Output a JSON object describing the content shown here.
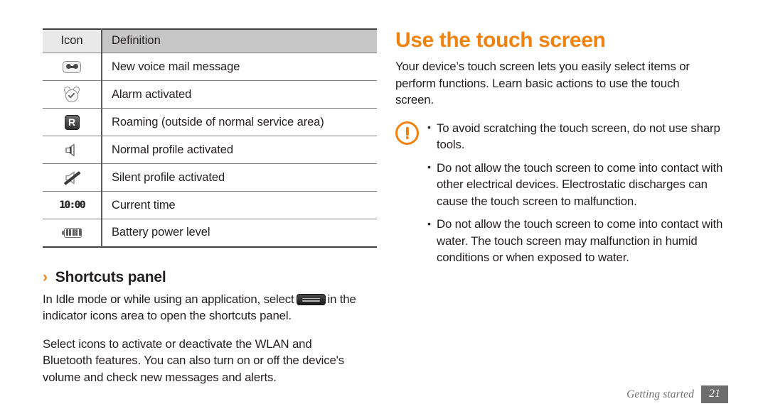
{
  "document": {
    "accent_color": "#f0830f",
    "text_color": "#231f20"
  },
  "left_column": {
    "table": {
      "headers": [
        "Icon",
        "Definition"
      ],
      "rows": [
        {
          "icon": "voicemail-icon",
          "definition": "New voice mail message"
        },
        {
          "icon": "alarm-clock-icon",
          "definition": "Alarm activated"
        },
        {
          "icon": "roaming-icon",
          "definition": "Roaming (outside of normal service area)"
        },
        {
          "icon": "speaker-normal-icon",
          "definition": "Normal profile activated"
        },
        {
          "icon": "speaker-muted-icon",
          "definition": "Silent profile activated"
        },
        {
          "icon": "current-time-icon",
          "definition": "Current time"
        },
        {
          "icon": "battery-icon",
          "definition": "Battery power level"
        }
      ],
      "icon_labels": {
        "roaming_letter": "R",
        "current_time_value": "10:00"
      }
    },
    "section": {
      "chevron": "›",
      "heading": "Shortcuts panel",
      "paragraph_1_before": "In Idle mode or while using an application, select",
      "paragraph_1_after": "in the indicator icons area to open the shortcuts panel.",
      "paragraph_2": "Select icons to activate or deactivate the WLAN and Bluetooth features. You can also turn on or off the device's volume and check new messages and alerts."
    }
  },
  "right_column": {
    "title": "Use the touch screen",
    "intro": "Your device’s touch screen lets you easily select items or perform functions. Learn basic actions to use the touch screen.",
    "caution": {
      "icon": "caution-icon",
      "bullets": [
        "To avoid scratching the touch screen, do not use sharp tools.",
        "Do not allow the touch screen to come into contact with other electrical devices. Electrostatic discharges can cause the touch screen to malfunction.",
        "Do not allow the touch screen to come into contact with water. The touch screen may malfunction in humid conditions or when exposed to water."
      ]
    }
  },
  "footer": {
    "section_label": "Getting started",
    "page_number": "21"
  }
}
